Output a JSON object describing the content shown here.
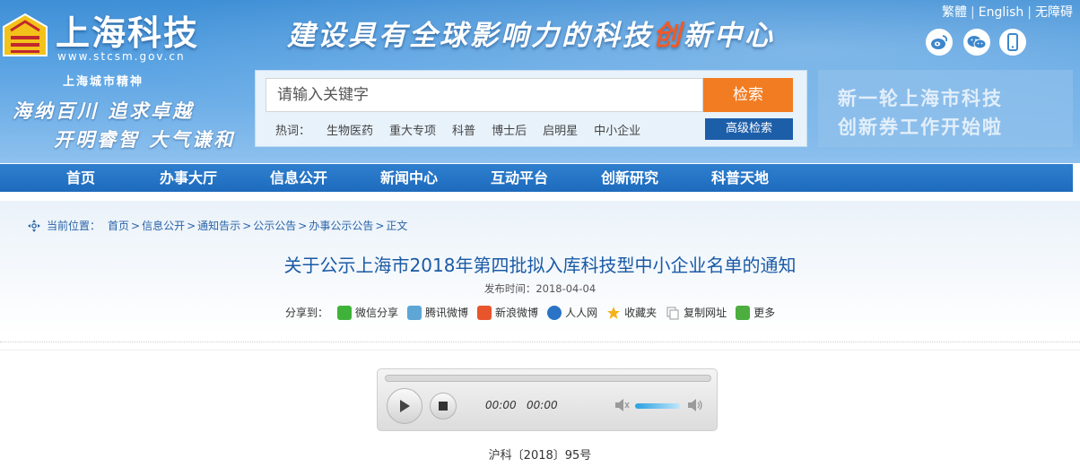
{
  "header": {
    "logo_text": "上海科技",
    "logo_url": "www.stcsm.gov.cn",
    "spirit_title": "上海城市精神",
    "spirit_line1": "海纳百川  追求卓越",
    "spirit_line2": "开明睿智  大气谦和",
    "slogan_main": "建设具有全球影响力的科技",
    "slogan_hl": "创",
    "slogan_end": "新中心",
    "top_links": [
      "繁體",
      "English",
      "无障碍"
    ],
    "social_icons": [
      "weibo-icon",
      "wechat-icon",
      "mobile-icon"
    ]
  },
  "search": {
    "placeholder": "请输入关键字",
    "button": "检索",
    "hot_label": "热词：",
    "hot_words": [
      "生物医药",
      "重大专项",
      "科普",
      "博士后",
      "启明星",
      "中小企业"
    ],
    "advanced": "高级检索"
  },
  "banner": {
    "line1": "新一轮上海市科技",
    "line2": "创新券工作开始啦"
  },
  "nav": [
    "首页",
    "办事大厅",
    "信息公开",
    "新闻中心",
    "互动平台",
    "创新研究",
    "科普天地"
  ],
  "breadcrumb": {
    "label": "当前位置：",
    "items": [
      "首页",
      "信息公开",
      "通知告示",
      "公示公告",
      "办事公示公告",
      "正文"
    ]
  },
  "article": {
    "title": "关于公示上海市2018年第四批拟入库科技型中小企业名单的通知",
    "date_label": "发布时间：",
    "date": "2018-04-04",
    "share_label": "分享到：",
    "share_items": [
      "微信分享",
      "腾讯微博",
      "新浪微博",
      "人人网",
      "收藏夹",
      "复制网址",
      "更多"
    ],
    "doc_no": "沪科〔2018〕95号"
  },
  "player": {
    "current_time": "00:00",
    "total_time": "00:00"
  },
  "colors": {
    "nav_bg": "#1e6bbd",
    "search_btn": "#f27c22",
    "title": "#1a5aa6"
  }
}
